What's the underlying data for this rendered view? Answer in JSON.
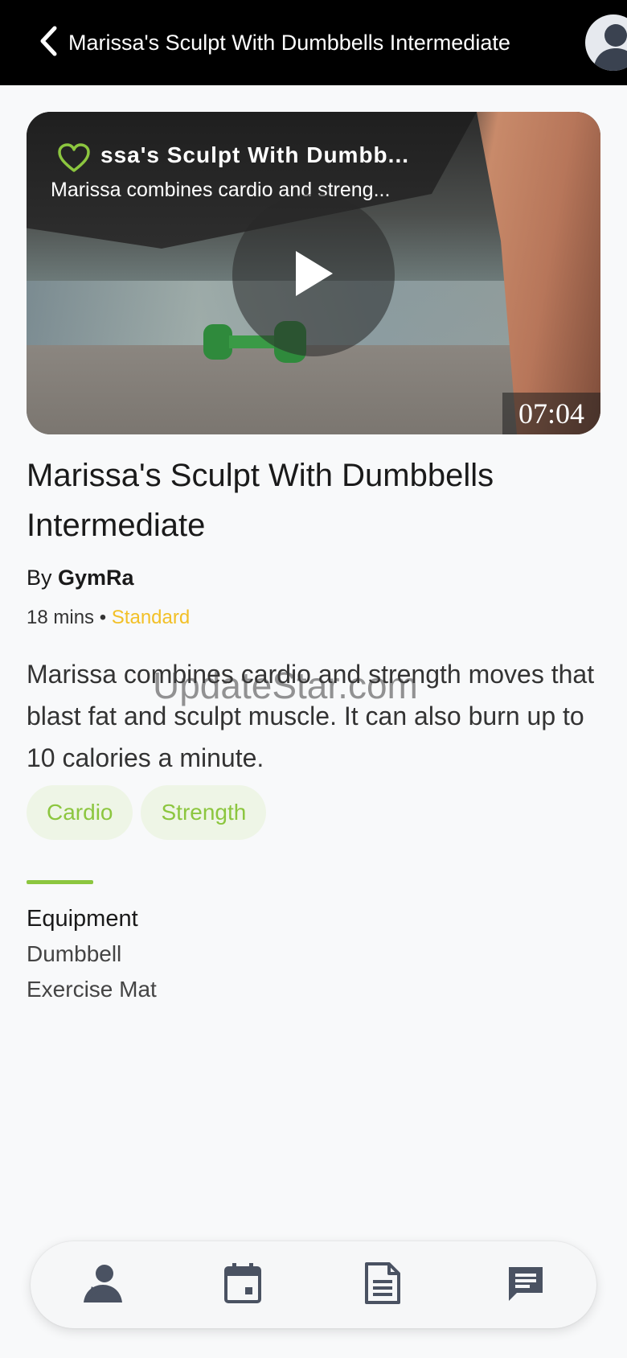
{
  "header": {
    "title": "Marissa's Sculpt With Dumbbells Intermediate",
    "back_icon": "chevron-left-icon",
    "avatar_icon": "user-avatar-icon"
  },
  "video": {
    "overlay_title": "ssa's Sculpt With Dumbb...",
    "overlay_subtitle": "Marissa combines cardio and streng...",
    "duration": "07:04",
    "favorite_icon": "heart-outline-icon",
    "play_icon": "play-icon"
  },
  "workout": {
    "title": "Marissa's Sculpt With Dumbbells Intermediate",
    "by_prefix": "By",
    "author": "GymRa",
    "duration": "18 mins",
    "separator": " • ",
    "level": "Standard",
    "description": "Marissa combines cardio and strength moves that blast fat and sculpt muscle. It can also burn up to 10 calories a minute.",
    "tags": [
      "Cardio",
      "Strength"
    ]
  },
  "watermark": "UpdateStar.com",
  "equipment": {
    "heading": "Equipment",
    "items": [
      "Dumbbell",
      "Exercise Mat"
    ]
  },
  "bottom_nav": {
    "items": [
      {
        "icon": "profile-icon"
      },
      {
        "icon": "calendar-icon"
      },
      {
        "icon": "document-icon"
      },
      {
        "icon": "chat-icon"
      }
    ]
  },
  "colors": {
    "accent_green": "#8cc63f",
    "level_yellow": "#f2c027",
    "header_bg": "#000000",
    "page_bg": "#f8f9fa"
  }
}
